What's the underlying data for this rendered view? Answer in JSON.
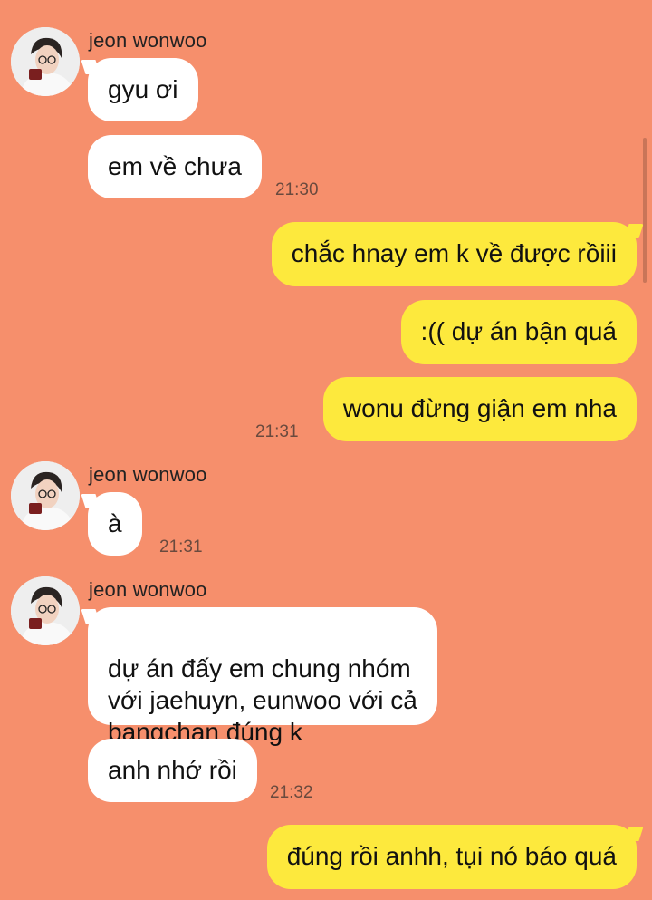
{
  "chat": {
    "contact_name": "jeon wonwoo",
    "messages": [
      {
        "text": "gyu ơi"
      },
      {
        "text": "em về chưa",
        "time": "21:30"
      },
      {
        "text": "chắc hnay em k về được rồiii"
      },
      {
        "text": ":(( dự án bận quá"
      },
      {
        "text": "wonu đừng giận em nha",
        "time": "21:31"
      },
      {
        "text": "à",
        "time": "21:31"
      },
      {
        "text": "dự án đấy em chung nhóm\nvới jaehuyn, eunwoo với cả\nbangchan đúng k"
      },
      {
        "text": "anh nhớ rồi",
        "time": "21:32"
      },
      {
        "text": "đúng rồi anhh, tụi nó báo quá"
      }
    ]
  },
  "colors": {
    "background": "#f68f6c",
    "incoming_bubble": "#ffffff",
    "outgoing_bubble": "#fde93d"
  }
}
